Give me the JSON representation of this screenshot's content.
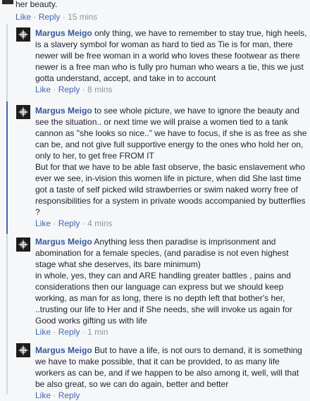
{
  "top_comment": {
    "text_tail": "her beauty.",
    "actions": {
      "like": "Like",
      "reply": "Reply",
      "time": "15 mins"
    }
  },
  "replies": [
    {
      "author": "Margus Meigo",
      "text": "only thing, we have to remember to stay true, high heels, is a slavery symbol for woman as hard to tied as Tie is for man, there newer will be free woman in a world who loves these footwear as there newer is a free man who is fully pro human who wears a tie, this we just gotta understand, accept, and take in to account",
      "actions": {
        "like": "Like",
        "reply": "Reply",
        "time": "8 mins"
      }
    },
    {
      "author": "Margus Meigo",
      "text": "to see whole picture, we have to ignore the beauty and see the situation.. or next time we will praise a women tied to a tank cannon as \"she looks so nice..\" we have to focus, if she is as free as she can be, and not give full supportive energy to the ones who hold her on, only to her, to get free FROM IT\nBut for that we have to be able fast observe, the basic enslavement who ever we see, in-vision this women life in picture, when did She last time got a taste of self picked wild strawberries or swim naked worry free of responsibilities for a system in private woods accompanied by butterflies ?",
      "actions": {
        "like": "Like",
        "reply": "Reply",
        "time": "4 mins"
      }
    },
    {
      "author": "Margus Meigo",
      "text": "Anything less then paradise is imprisonment and abomination for a female species, (and paradise is not even highest stage what she deserves, its bare minimum)\nin whole, yes, they can and ARE handling greater battles , pains and considerations then our language can express but we should keep working, as man for as long, there is no depth left that bother's her, ..trusting our life to Her and if She needs, she will invoke us again for Good works gifting us with life",
      "actions": {
        "like": "Like",
        "reply": "Reply",
        "time": "1 min"
      }
    },
    {
      "author": "Margus Meigo",
      "text": "But to have a life, is not ours to demand, it is something we have to make possible, that it can be provided, to as many life workers as can be, and if we happen to be also among it, well, will that be also great, so we can do again, better and better",
      "actions": {
        "like": "Like",
        "reply": "Reply",
        "time": ""
      }
    }
  ]
}
